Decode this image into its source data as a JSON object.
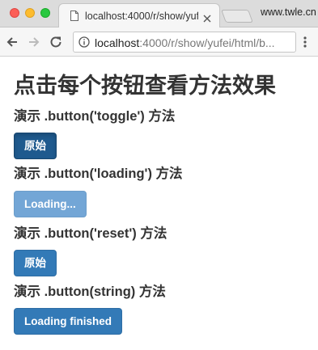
{
  "browser": {
    "tab_title": "localhost:4000/r/show/yufei/html/b...",
    "profile_label": "www.twle.cn",
    "url_host": "localhost",
    "url_rest": ":4000/r/show/yufei/html/b..."
  },
  "page": {
    "heading": "点击每个按钮查看方法效果",
    "sections": [
      {
        "label": "演示 .button('toggle') 方法",
        "button": "原始",
        "state": "active"
      },
      {
        "label": "演示 .button('loading') 方法",
        "button": "Loading...",
        "state": "disabled"
      },
      {
        "label": "演示 .button('reset') 方法",
        "button": "原始",
        "state": "normal"
      },
      {
        "label": "演示 .button(string) 方法",
        "button": "Loading finished",
        "state": "normal"
      }
    ]
  },
  "colors": {
    "button_primary": "#337ab7",
    "button_active": "#1f5a8e",
    "button_disabled": "#73a6d6",
    "text": "#333333"
  }
}
